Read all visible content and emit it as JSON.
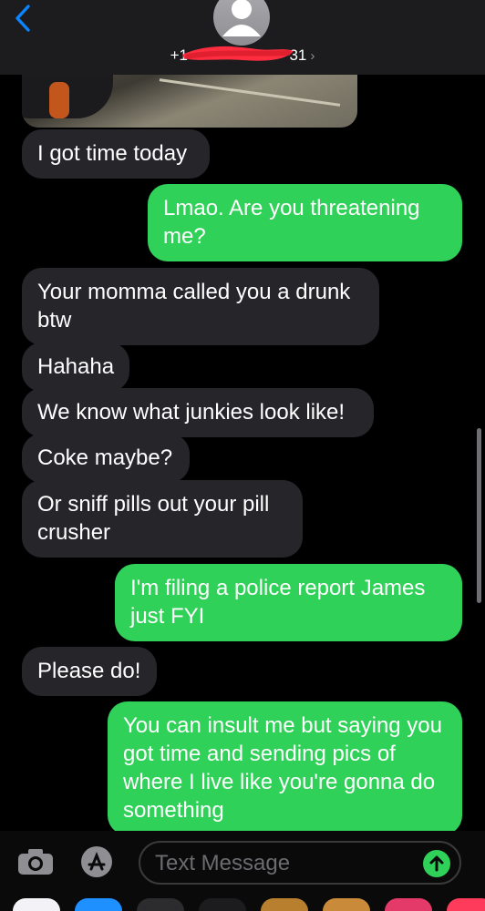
{
  "header": {
    "contact_left": "+1",
    "contact_right": "31"
  },
  "messages": [
    {
      "dir": "in",
      "text": "I got time today"
    },
    {
      "dir": "out",
      "text": "Lmao.   Are you threatening me?"
    },
    {
      "dir": "in",
      "text": "Your momma called you a drunk btw"
    },
    {
      "dir": "in",
      "text": "Hahaha"
    },
    {
      "dir": "in",
      "text": "We know what junkies look like!"
    },
    {
      "dir": "in",
      "text": "Coke maybe?"
    },
    {
      "dir": "in",
      "text": "Or sniff pills out your pill crusher"
    },
    {
      "dir": "out",
      "text": "I'm filing a police report James just FYI"
    },
    {
      "dir": "in",
      "text": "Please do!"
    },
    {
      "dir": "out",
      "text": "You can insult me but saying you got time and sending pics of where I live like you're gonna do something"
    }
  ],
  "input": {
    "placeholder": "Text Message"
  },
  "colors": {
    "incoming_bubble": "#26252a",
    "outgoing_bubble": "#30d158",
    "accent": "#0a84ff"
  },
  "icons": {
    "back": "chevron-left-icon",
    "camera": "camera-icon",
    "apps": "app-store-icon",
    "send": "arrow-up-icon"
  }
}
